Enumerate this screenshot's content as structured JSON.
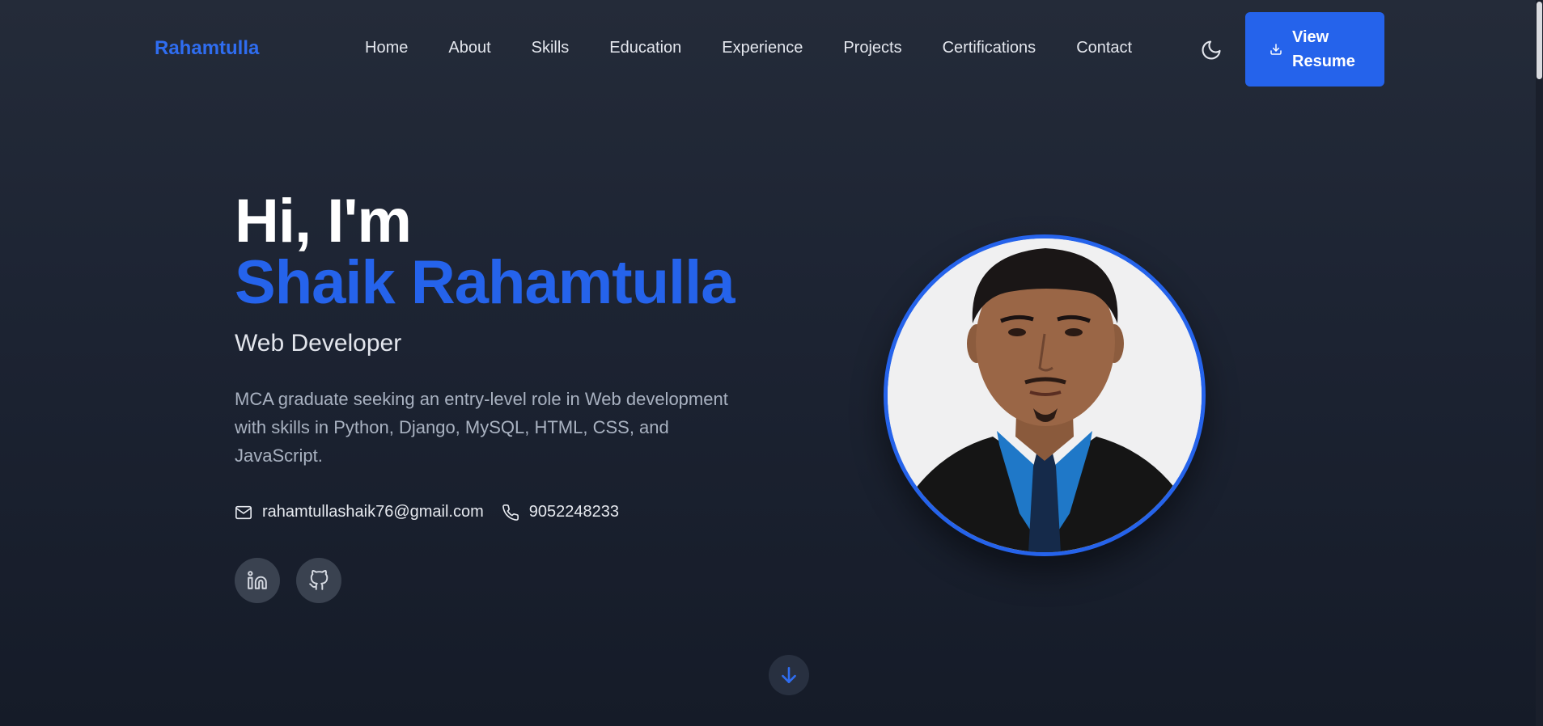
{
  "nav": {
    "brand": "Rahamtulla",
    "links": [
      "Home",
      "About",
      "Skills",
      "Education",
      "Experience",
      "Projects",
      "Certifications",
      "Contact"
    ],
    "theme_toggle_icon": "moon-icon",
    "resume_button": {
      "icon": "download-icon",
      "label": "View Resume"
    }
  },
  "hero": {
    "greeting": "Hi, I'm",
    "name": "Shaik Rahamtulla",
    "role": "Web Developer",
    "bio": "MCA graduate seeking an entry-level role in Web development with skills in Python, Django, MySQL, HTML, CSS, and JavaScript.",
    "email": "rahamtullashaik76@gmail.com",
    "phone": "9052248233",
    "email_icon": "mail-icon",
    "phone_icon": "phone-icon",
    "socials": [
      {
        "icon": "linkedin-icon"
      },
      {
        "icon": "github-icon"
      }
    ],
    "avatar": "profile-photo"
  },
  "scroll_down_icon": "arrow-down-icon",
  "colors": {
    "accent": "#2563eb",
    "background": "#1d2433",
    "text": "#ffffff",
    "muted_text": "#a9b2c1",
    "social_bg": "#3a4250"
  }
}
